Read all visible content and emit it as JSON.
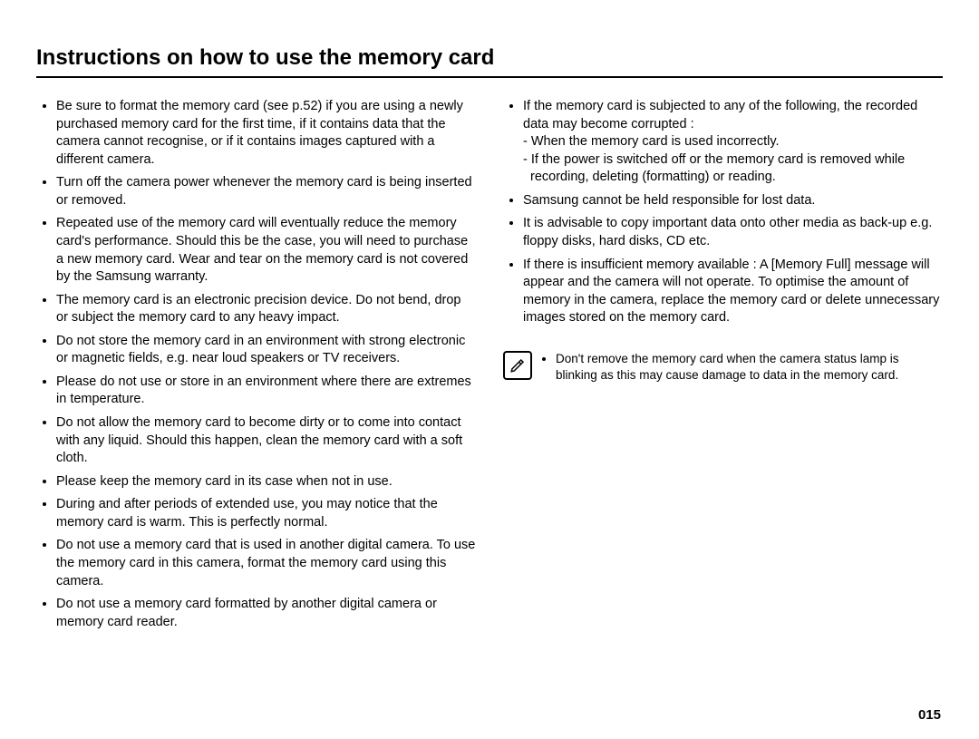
{
  "title": "Instructions on how to use the memory card",
  "left_bullets": [
    "Be sure to format the memory card (see p.52) if you are using a newly purchased memory card for the first time, if it contains data that the camera cannot recognise, or if it contains images captured with a different camera.",
    "Turn off the camera power whenever the memory card is being inserted or removed.",
    "Repeated use of the memory card will eventually reduce the memory card's performance. Should this be the case, you will need to purchase a new memory card. Wear and tear on the memory card is not covered by the Samsung warranty.",
    "The memory card is an electronic precision device. Do not bend, drop or subject the memory card to any heavy impact.",
    "Do not store the memory card in an environment with strong electronic or magnetic fields, e.g. near loud speakers or TV receivers.",
    "Please do not use or store in an environment where there are extremes in temperature.",
    "Do not allow the memory card to become dirty or to come into contact with any liquid. Should this happen, clean the memory card with a soft cloth.",
    "Please keep the memory card in its case when not in use.",
    "During and after periods of extended use, you may notice that the memory card is warm. This is perfectly normal.",
    "Do not use a memory card that is used in another digital camera. To use the memory card in this camera, format the memory card using this camera.",
    "Do not use a memory card formatted by another digital camera or memory card reader."
  ],
  "right_bullet_1_main": "If the memory card is subjected to any of the following, the recorded data may become corrupted :",
  "right_bullet_1_sub_a": "- When the memory card is used incorrectly.",
  "right_bullet_1_sub_b": "- If the power is switched off or the memory card is removed while recording, deleting (formatting) or reading.",
  "right_bullets_rest": [
    "Samsung cannot be held responsible for lost data.",
    "It is advisable to copy important data onto other media as back-up e.g. floppy disks, hard disks, CD etc.",
    "If there is insufficient memory available : A [Memory Full] message will appear and the camera will not operate. To optimise the amount of memory in the camera, replace the memory card or delete unnecessary images stored on the memory card."
  ],
  "note_text": "Don't remove the memory card when the camera status lamp is blinking as this may cause damage to data in the memory card.",
  "page_number": "015"
}
